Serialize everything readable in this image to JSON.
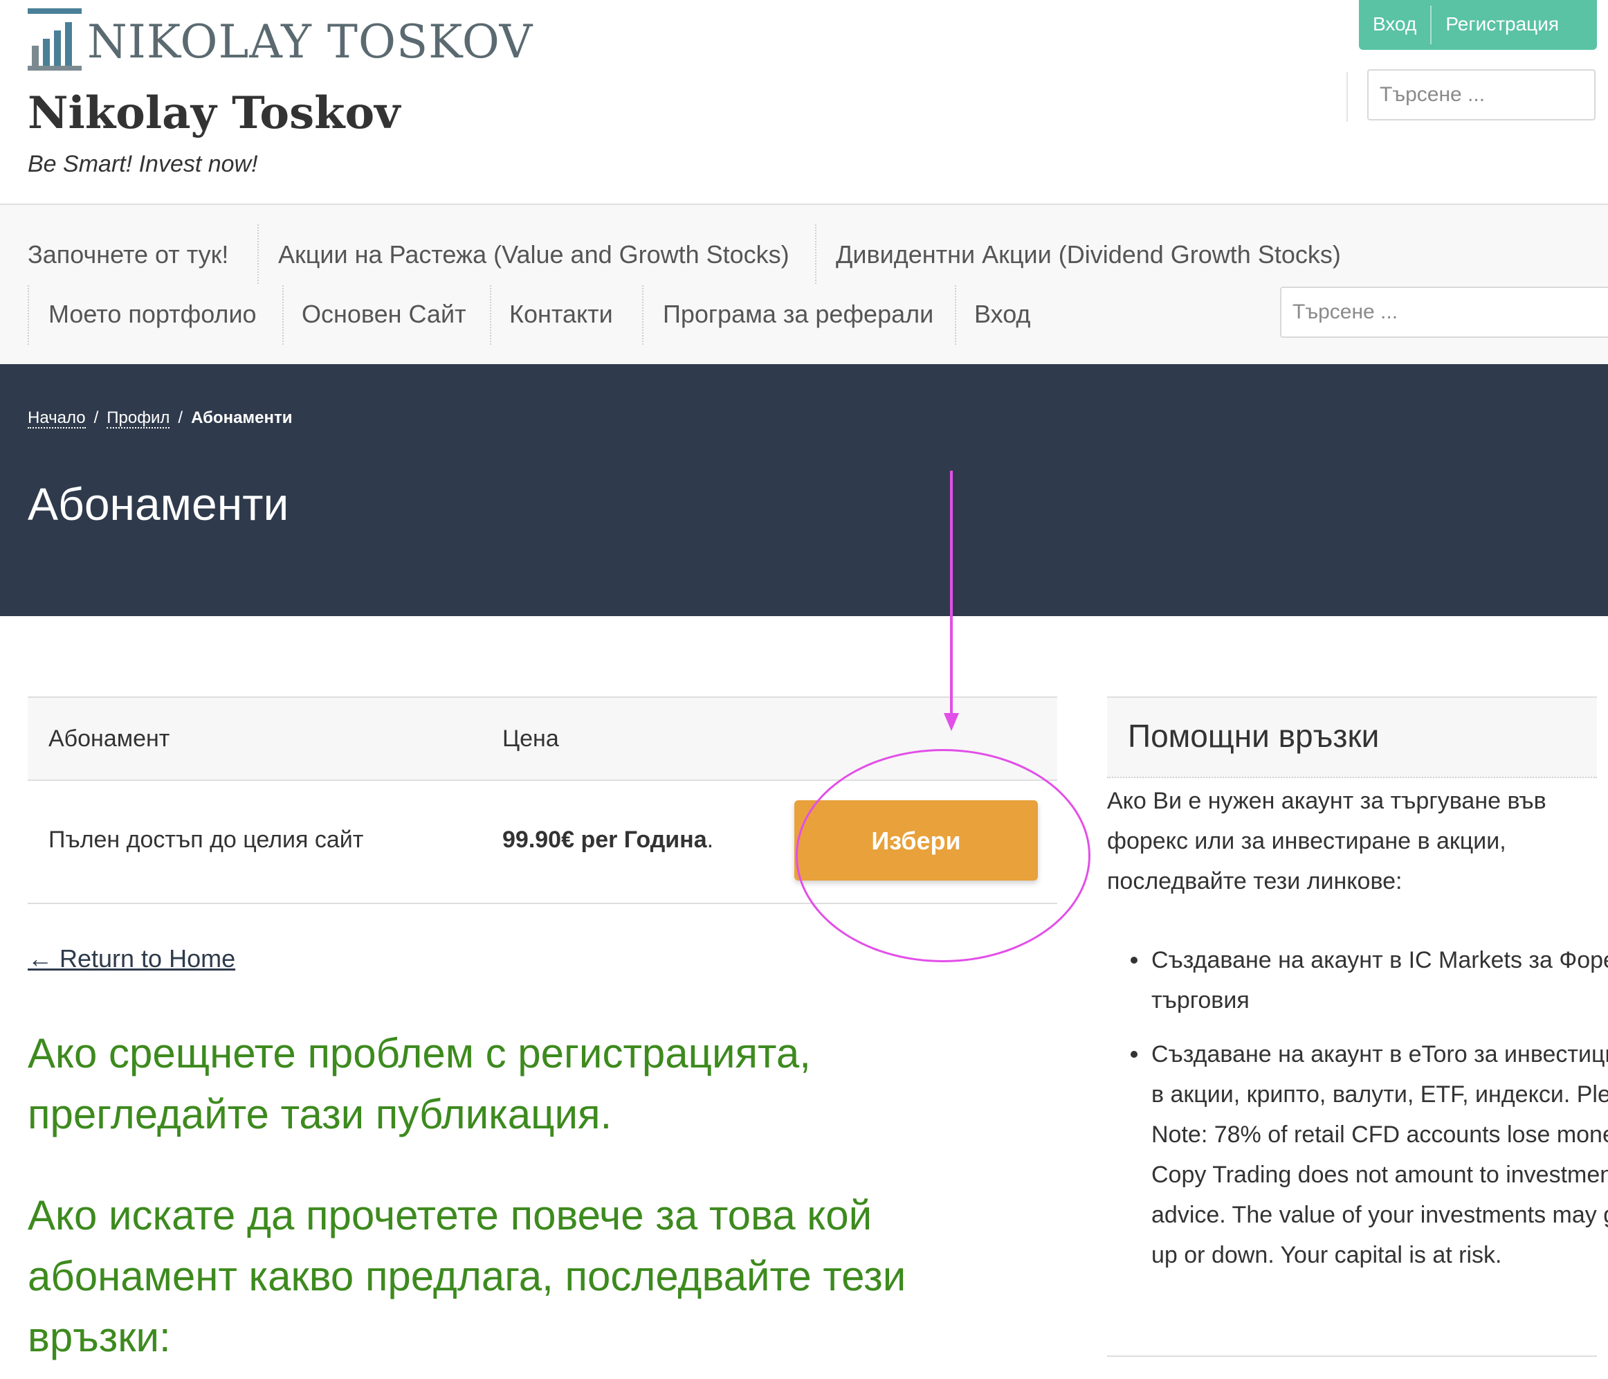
{
  "header": {
    "logo_text": "NIKOLAY TOSKOV",
    "site_title": "Nikolay Toskov",
    "tagline": "Be Smart! Invest now!",
    "login_label": "Вход",
    "register_label": "Регистрация",
    "search_placeholder": "Търсене ..."
  },
  "nav": {
    "items": [
      "Започнете от тук!",
      "Акции на Растежа (Value and Growth Stocks)",
      "Дивидентни Акции (Dividend Growth Stocks)",
      "Моето портфолио",
      "Основен Сайт",
      "Контакти",
      "Програма за реферали",
      "Вход"
    ],
    "search_placeholder": "Търсене ..."
  },
  "breadcrumb": {
    "home": "Начало",
    "profile": "Профил",
    "current": "Абонаменти",
    "separator": "/"
  },
  "page_title": "Абонаменти",
  "table": {
    "col_subscription": "Абонамент",
    "col_price": "Цена",
    "row": {
      "name": "Пълен достъп до целия сайт",
      "price": "99.90€ per Година",
      "price_suffix": ".",
      "button_label": "Избери"
    }
  },
  "return_link": "← Return to Home",
  "notices": [
    "Ако срещнете проблем с регистрацията, прегледайте тази публикация.",
    "Ако искате да прочетете повече за това кой абонамент какво предлага, последвайте тези връзки:"
  ],
  "sidebar": {
    "title": "Помощни връзки",
    "intro": "Ако Ви е нужен акаунт за търгуване във форекс или за инвестиране в акции, последвайте тези линкове:",
    "links": [
      "Създаване на акаунт в IC Markets за Форекс търговия",
      "Създаване на акаунт в eToro за инвестиции в акции, крипто, валути, ETF, индекси. Please Note: 78% of retail CFD accounts lose money. Copy Trading does not amount to investment advice. The value of your investments may go up or down. Your capital is at risk."
    ]
  },
  "colors": {
    "hero_bg": "#2f3b4c",
    "auth_green": "#59c3a3",
    "select_orange": "#e8a13b",
    "notice_green": "#3d8a1e",
    "annotation_magenta": "#e24fe8"
  }
}
